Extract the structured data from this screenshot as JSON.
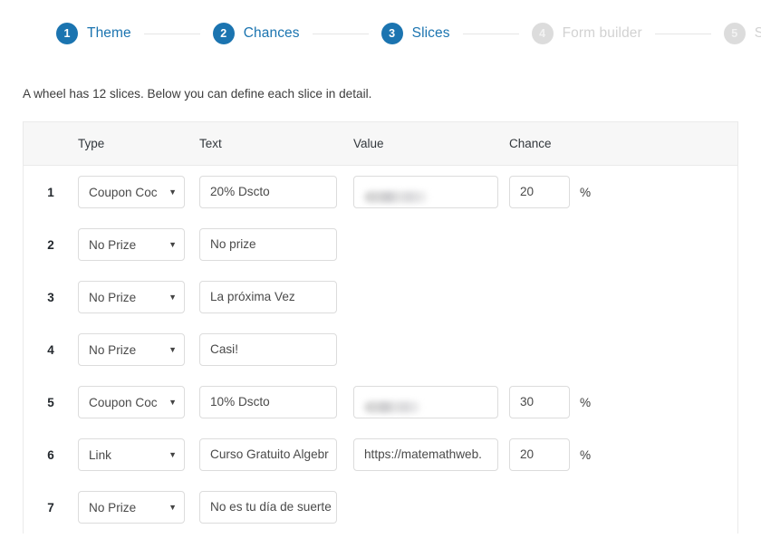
{
  "stepper": {
    "steps": [
      {
        "number": "1",
        "label": "Theme",
        "state": "active"
      },
      {
        "number": "2",
        "label": "Chances",
        "state": "active"
      },
      {
        "number": "3",
        "label": "Slices",
        "state": "active"
      },
      {
        "number": "4",
        "label": "Form builder",
        "state": "inactive"
      },
      {
        "number": "5",
        "label": "Settings",
        "state": "inactive"
      }
    ],
    "active_color": "#1b74b0",
    "inactive_color": "#d2d2d2"
  },
  "description": "A wheel has 12 slices. Below you can define each slice in detail.",
  "table": {
    "headers": {
      "number": "",
      "type": "Type",
      "text": "Text",
      "value": "Value",
      "chance": "Chance"
    },
    "percent_symbol": "%",
    "caret_glyph": "▼",
    "rows": [
      {
        "number": "1",
        "type": "Coupon Coc",
        "text": "20% Dscto",
        "value": "",
        "value_blurred": true,
        "chance": "20",
        "show_chance": true
      },
      {
        "number": "2",
        "type": "No Prize",
        "text": "No prize",
        "value": "",
        "value_blurred": false,
        "chance": "",
        "show_chance": false
      },
      {
        "number": "3",
        "type": "No Prize",
        "text": "La próxima Vez",
        "value": "",
        "value_blurred": false,
        "chance": "",
        "show_chance": false
      },
      {
        "number": "4",
        "type": "No Prize",
        "text": "Casi!",
        "value": "",
        "value_blurred": false,
        "chance": "",
        "show_chance": false
      },
      {
        "number": "5",
        "type": "Coupon Coc",
        "text": "10% Dscto",
        "value": "",
        "value_blurred": true,
        "chance": "30",
        "show_chance": true
      },
      {
        "number": "6",
        "type": "Link",
        "text": "Curso Gratuito Algebr",
        "value": "https://matemathweb.",
        "value_blurred": false,
        "chance": "20",
        "show_chance": true
      },
      {
        "number": "7",
        "type": "No Prize",
        "text": "No es tu día de suerte",
        "value": "",
        "value_blurred": false,
        "chance": "",
        "show_chance": false
      }
    ]
  }
}
